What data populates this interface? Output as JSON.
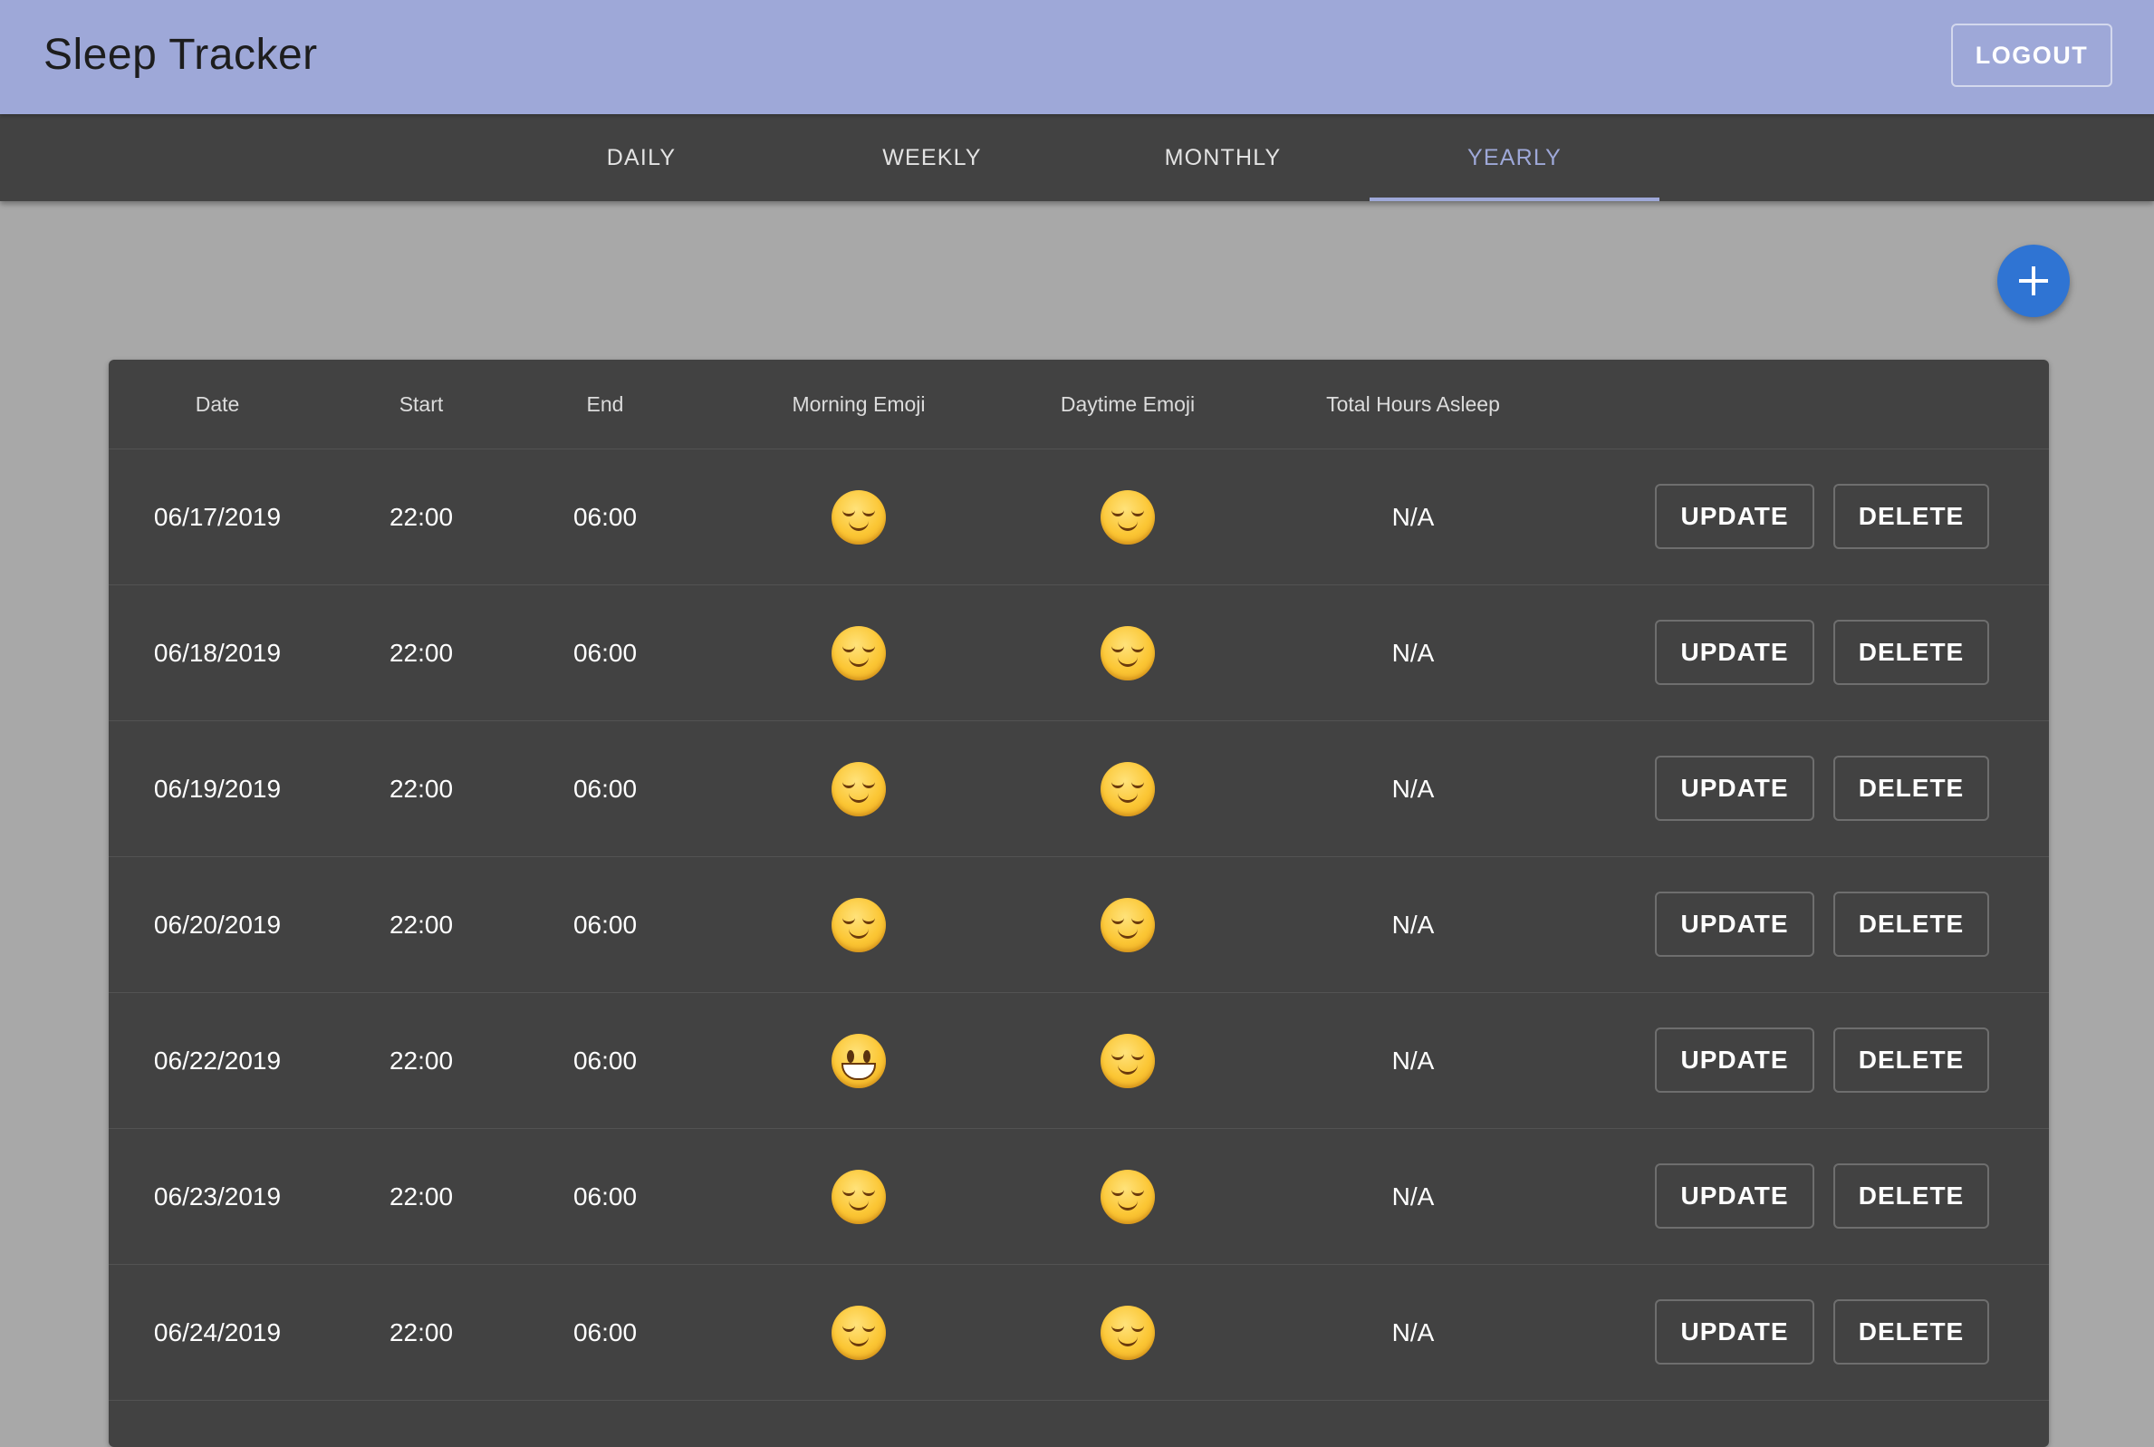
{
  "app_bar": {
    "title": "Sleep Tracker",
    "logout_label": "LOGOUT"
  },
  "tabs": [
    {
      "label": "DAILY",
      "active": false
    },
    {
      "label": "WEEKLY",
      "active": false
    },
    {
      "label": "MONTHLY",
      "active": false
    },
    {
      "label": "YEARLY",
      "active": true
    }
  ],
  "fab": {
    "icon": "plus-icon"
  },
  "table": {
    "headers": {
      "date": "Date",
      "start": "Start",
      "end": "End",
      "morning_emoji": "Morning Emoji",
      "daytime_emoji": "Daytime Emoji",
      "total_hours": "Total Hours Asleep"
    },
    "rows": [
      {
        "date": "06/17/2019",
        "start": "22:00",
        "end": "06:00",
        "morning_emoji": "relieved-face",
        "daytime_emoji": "relieved-face",
        "total": "N/A",
        "update_label": "UPDATE",
        "delete_label": "DELETE"
      },
      {
        "date": "06/18/2019",
        "start": "22:00",
        "end": "06:00",
        "morning_emoji": "relieved-face",
        "daytime_emoji": "relieved-face",
        "total": "N/A",
        "update_label": "UPDATE",
        "delete_label": "DELETE"
      },
      {
        "date": "06/19/2019",
        "start": "22:00",
        "end": "06:00",
        "morning_emoji": "relieved-face",
        "daytime_emoji": "relieved-face",
        "total": "N/A",
        "update_label": "UPDATE",
        "delete_label": "DELETE"
      },
      {
        "date": "06/20/2019",
        "start": "22:00",
        "end": "06:00",
        "morning_emoji": "relieved-face",
        "daytime_emoji": "relieved-face",
        "total": "N/A",
        "update_label": "UPDATE",
        "delete_label": "DELETE"
      },
      {
        "date": "06/22/2019",
        "start": "22:00",
        "end": "06:00",
        "morning_emoji": "grinning-face",
        "daytime_emoji": "relieved-face",
        "total": "N/A",
        "update_label": "UPDATE",
        "delete_label": "DELETE"
      },
      {
        "date": "06/23/2019",
        "start": "22:00",
        "end": "06:00",
        "morning_emoji": "relieved-face",
        "daytime_emoji": "relieved-face",
        "total": "N/A",
        "update_label": "UPDATE",
        "delete_label": "DELETE"
      },
      {
        "date": "06/24/2019",
        "start": "22:00",
        "end": "06:00",
        "morning_emoji": "relieved-face",
        "daytime_emoji": "relieved-face",
        "total": "N/A",
        "update_label": "UPDATE",
        "delete_label": "DELETE"
      }
    ]
  },
  "colors": {
    "app_bar": "#9ea8d8",
    "tab_bar": "#424242",
    "active_tab": "#9ea8d8",
    "page_background": "#a8a8a8",
    "table_background": "#424242",
    "fab": "#2f74d3"
  }
}
